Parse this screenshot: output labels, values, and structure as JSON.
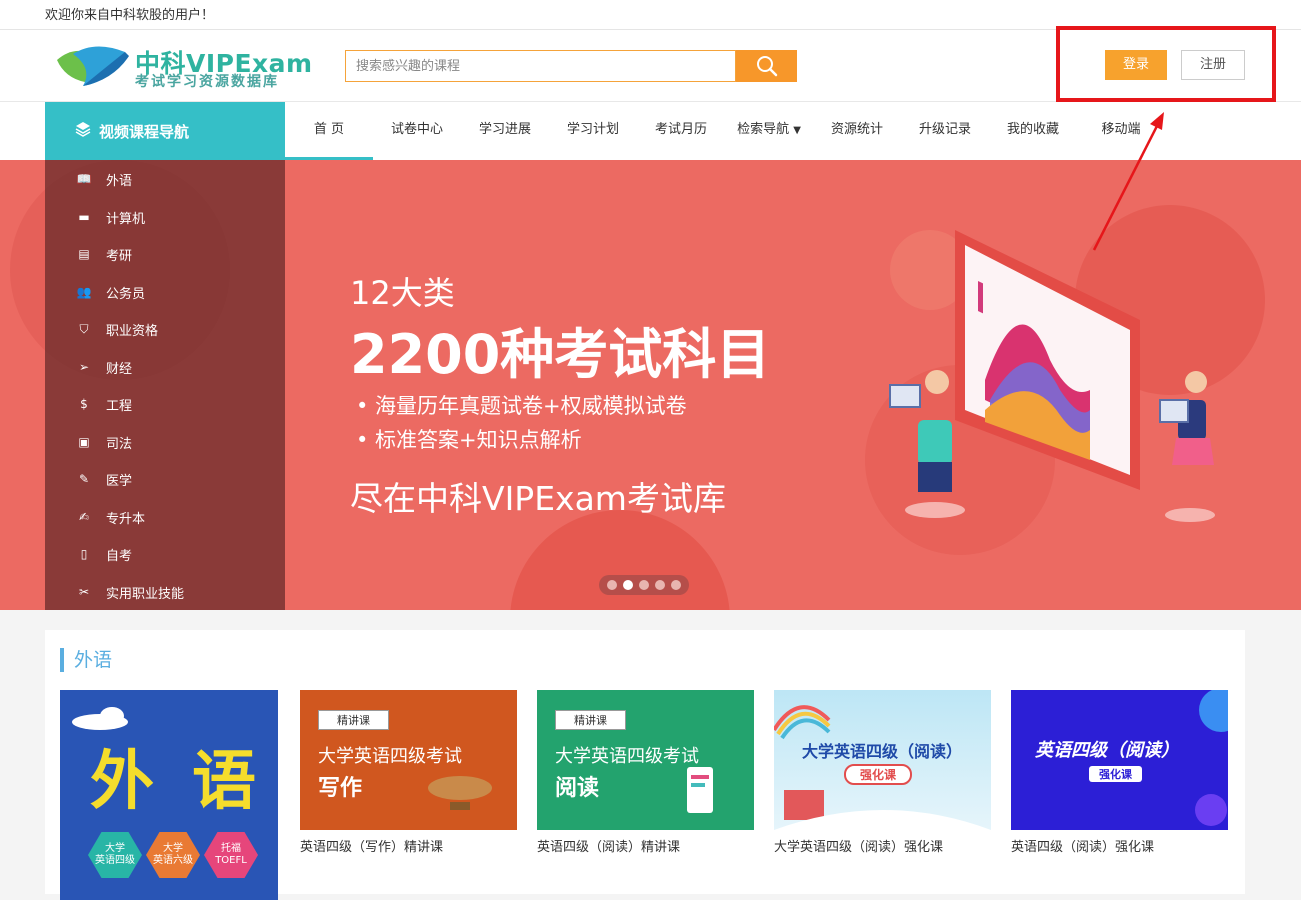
{
  "topbar": {
    "welcome": "欢迎你来自中科软股的用户！"
  },
  "header": {
    "logo_title": "中科VIPExam",
    "logo_subtitle": "考试学习资源数据库",
    "search_placeholder": "搜索感兴趣的课程",
    "login_label": "登录",
    "register_label": "注册"
  },
  "nav": {
    "category_label": "视频课程导航",
    "items": [
      "首 页",
      "试卷中心",
      "学习进展",
      "学习计划",
      "考试月历",
      "检索导航",
      "资源统计",
      "升级记录",
      "我的收藏",
      "移动端"
    ]
  },
  "sidebar": {
    "items": [
      "外语",
      "计算机",
      "考研",
      "公务员",
      "职业资格",
      "财经",
      "工程",
      "司法",
      "医学",
      "专升本",
      "自考",
      "实用职业技能"
    ]
  },
  "banner": {
    "line1": "12大类",
    "line2": "2200种考试科目",
    "bullet1": "• 海量历年真题试卷+权威模拟试卷",
    "bullet2": "• 标准答案+知识点解析",
    "slogan": "尽在中科VIPExam考试库"
  },
  "section": {
    "title": "外语",
    "big_card": {
      "title_a": "外",
      "title_b": "语",
      "hex1": "大学\n英语四级",
      "hex2": "大学\n英语六级",
      "hex3": "托福\nTOEFL"
    },
    "cards": [
      {
        "tag": "精讲课",
        "title": "大学英语四级考试",
        "subtitle": "写作",
        "caption": "英语四级（写作）精讲课",
        "color": "#d0571f"
      },
      {
        "tag": "精讲课",
        "title": "大学英语四级考试",
        "subtitle": "阅读",
        "caption": "英语四级（阅读）精讲课",
        "color": "#23a36e"
      },
      {
        "title": "大学英语四级（阅读）",
        "badge": "强化课",
        "caption": "大学英语四级（阅读）强化课",
        "color": "#9bd4ee"
      },
      {
        "title": "英语四级（阅读）",
        "badge": "强化课",
        "caption": "英语四级（阅读）强化课",
        "color": "#2c1fd6"
      }
    ]
  },
  "colors": {
    "accent": "#35bfc7",
    "orange": "#f7972a",
    "banner": "#ec6a62",
    "highlight": "#e6161a"
  }
}
